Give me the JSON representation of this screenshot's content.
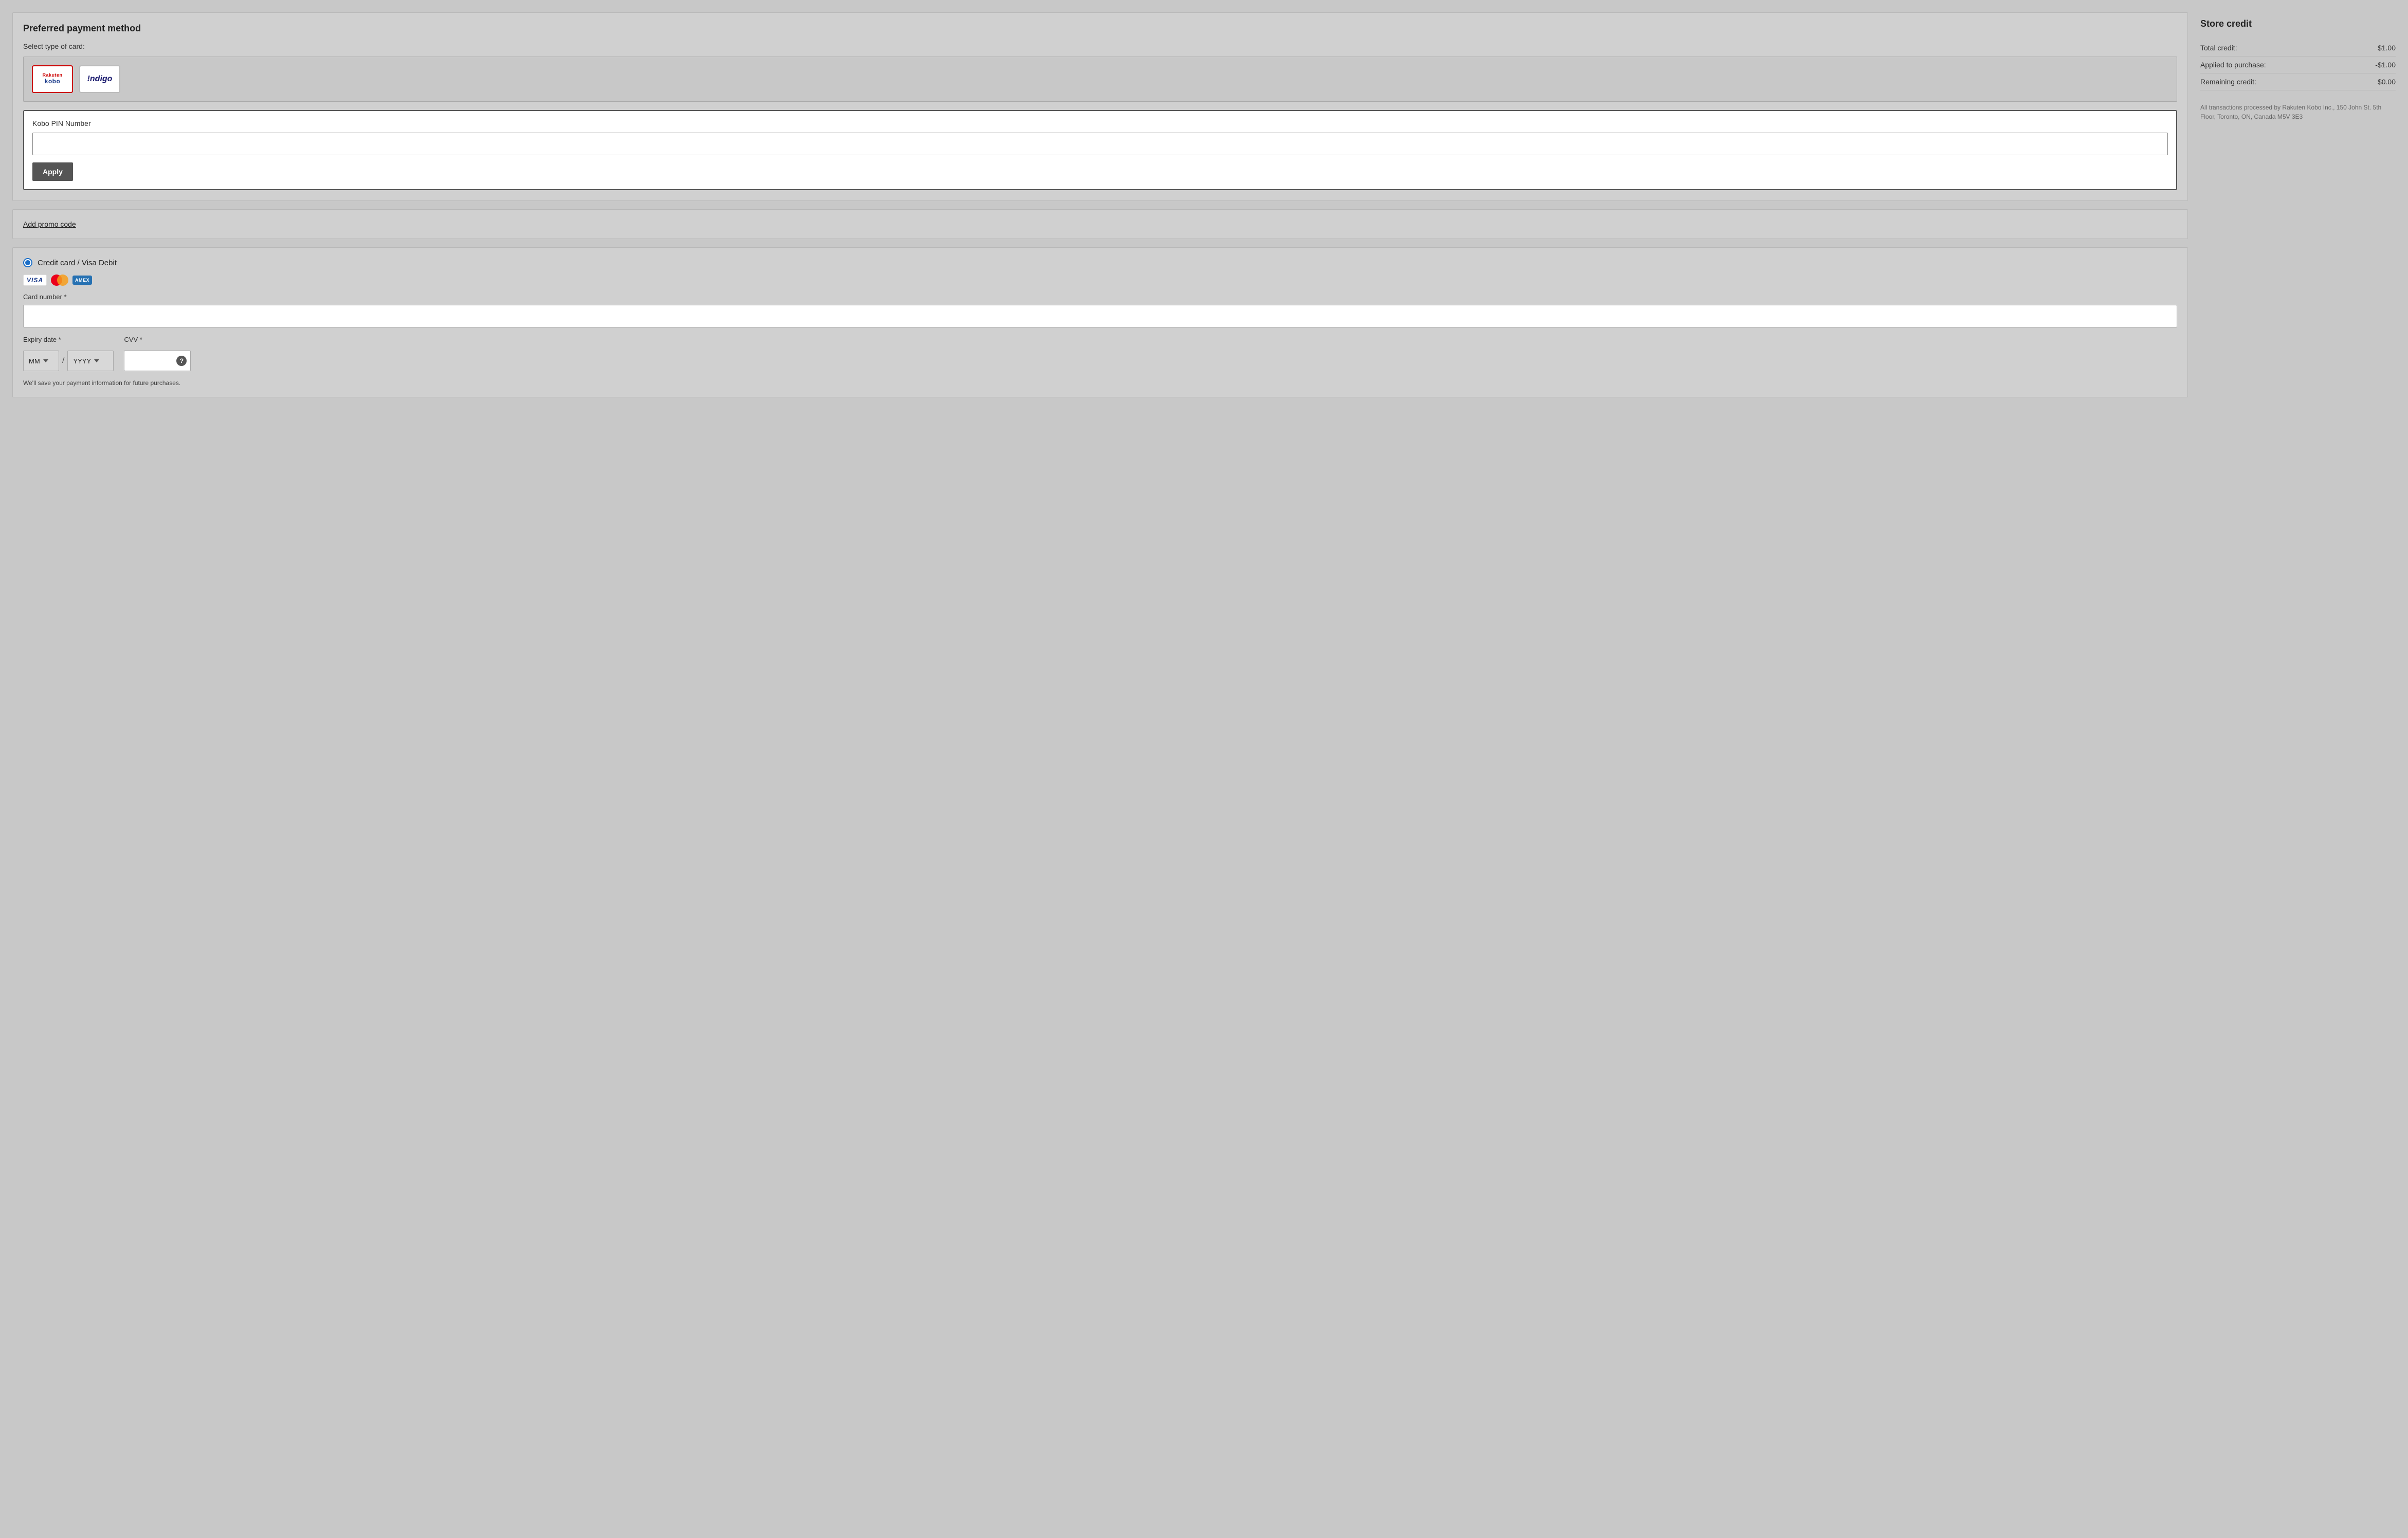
{
  "left": {
    "preferred_payment_title": "Preferred payment method",
    "select_card_label": "Select type of card:",
    "card_options": [
      {
        "id": "rakuten-kobo",
        "rakuten_text": "Rakuten",
        "kobo_text": "kobo",
        "selected": true
      },
      {
        "id": "indigo",
        "text": "!ndigo",
        "selected": false
      }
    ],
    "pin_section": {
      "label": "Kobo PIN Number",
      "input_placeholder": "",
      "apply_button_label": "Apply"
    },
    "promo": {
      "link_text": "Add promo code"
    },
    "payment": {
      "radio_label": "Credit card / Visa Debit",
      "card_number_label": "Card number *",
      "expiry_label": "Expiry date *",
      "cvv_label": "CVV *",
      "month_placeholder": "MM",
      "year_placeholder": "YYYY",
      "save_text": "We'll save your payment information for future purchases."
    }
  },
  "right": {
    "store_credit_title": "Store credit",
    "credit_rows": [
      {
        "label": "Total credit:",
        "value": "$1.00"
      },
      {
        "label": "Applied to purchase:",
        "value": "-$1.00"
      },
      {
        "label": "Remaining credit:",
        "value": "$0.00"
      }
    ],
    "transactions_text": "All transactions processed by Rakuten Kobo Inc., 150 John St. 5th Floor, Toronto, ON, Canada M5V 3E3"
  }
}
